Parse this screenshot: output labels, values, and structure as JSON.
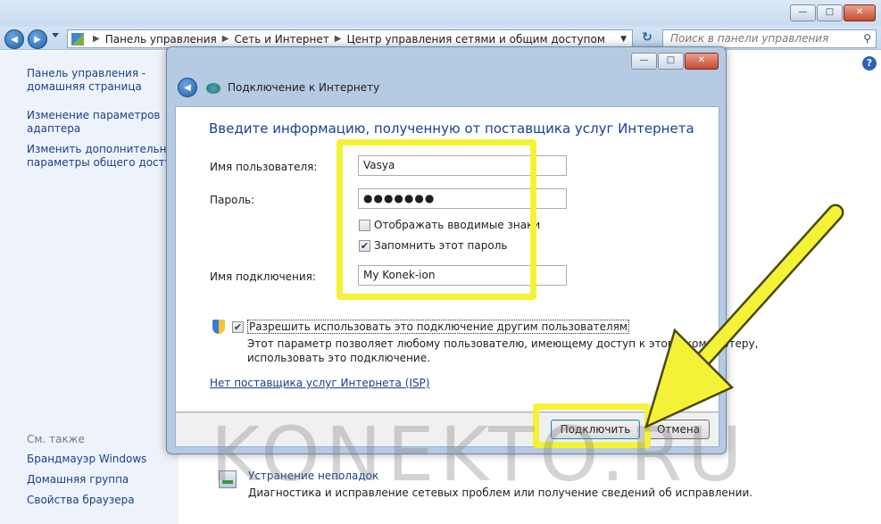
{
  "window": {
    "minimize_label": "—",
    "maximize_label": "□",
    "close_label": "✕"
  },
  "nav": {
    "back_icon": "◀",
    "forward_icon": "▶",
    "breadcrumb": [
      "Панель управления",
      "Сеть и Интернет",
      "Центр управления сетями и общим доступом"
    ],
    "refresh_icon": "↻",
    "search_placeholder": "Поиск в панели управления"
  },
  "sidebar": {
    "links": [
      {
        "line1": "Панель управления -",
        "line2": "домашняя страница"
      },
      {
        "line1": "Изменение параметров",
        "line2": "адаптера"
      },
      {
        "line1": "Изменить дополнительные",
        "line2": "параметры общего доступа"
      }
    ],
    "see_also_label": "См. также",
    "see_also": [
      "Брандмауэр Windows",
      "Домашняя группа",
      "Свойства браузера"
    ]
  },
  "main": {
    "troubleshoot_title": "Устранение неполадок",
    "troubleshoot_desc": "Диагностика и исправление сетевых проблем или получение сведений об исправлении."
  },
  "dialog": {
    "title": "Подключение к Интернету",
    "heading": "Введите информацию, полученную от поставщика услуг Интернета",
    "username_label": "Имя пользователя:",
    "username_value": "Vasya",
    "password_label": "Пароль:",
    "password_value": "●●●●●●●",
    "show_chars_label": "Отображать вводимые знаки",
    "show_chars_checked": false,
    "remember_label": "Запомнить этот пароль",
    "remember_checked": true,
    "conn_name_label": "Имя подключения:",
    "conn_name_value": "My Konek-ion",
    "allow_others_label": "Разрешить использовать это подключение другим пользователям",
    "allow_others_checked": true,
    "allow_desc_line1": "Этот параметр позволяет любому пользователю, имеющему доступ к этому компьютеру,",
    "allow_desc_line2": "использовать это подключение.",
    "no_isp_link": "Нет поставщика услуг Интернета (ISP)",
    "connect_button": "Подключить",
    "cancel_button": "Отмена"
  },
  "watermark": "KONEKTO.RU",
  "colors": {
    "highlight": "#f4f236",
    "link": "#1a3f8a",
    "heading": "#1a3f9a"
  }
}
